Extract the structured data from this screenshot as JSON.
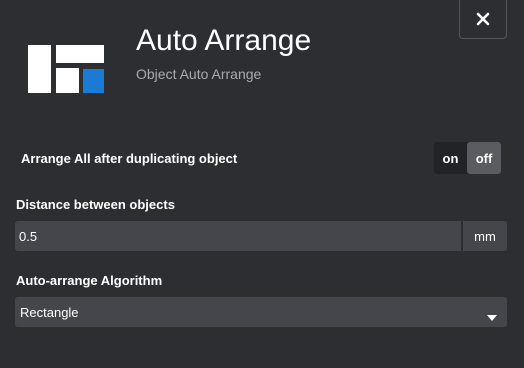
{
  "dialog": {
    "title": "Auto Arrange",
    "subtitle": "Object Auto Arrange",
    "close_icon": "close-icon",
    "logo_icon": "auto-arrange-logo",
    "accent_color": "#1a7ad4"
  },
  "settings": {
    "arrange_after_duplicate": {
      "label": "Arrange All after duplicating object",
      "on_label": "on",
      "off_label": "off",
      "selected": "off"
    },
    "distance": {
      "label": "Distance between objects",
      "value": "0.5",
      "unit": "mm"
    },
    "algorithm": {
      "label": "Auto-arrange Algorithm",
      "selected": "Rectangle",
      "caret_icon": "caret-down-icon"
    }
  }
}
